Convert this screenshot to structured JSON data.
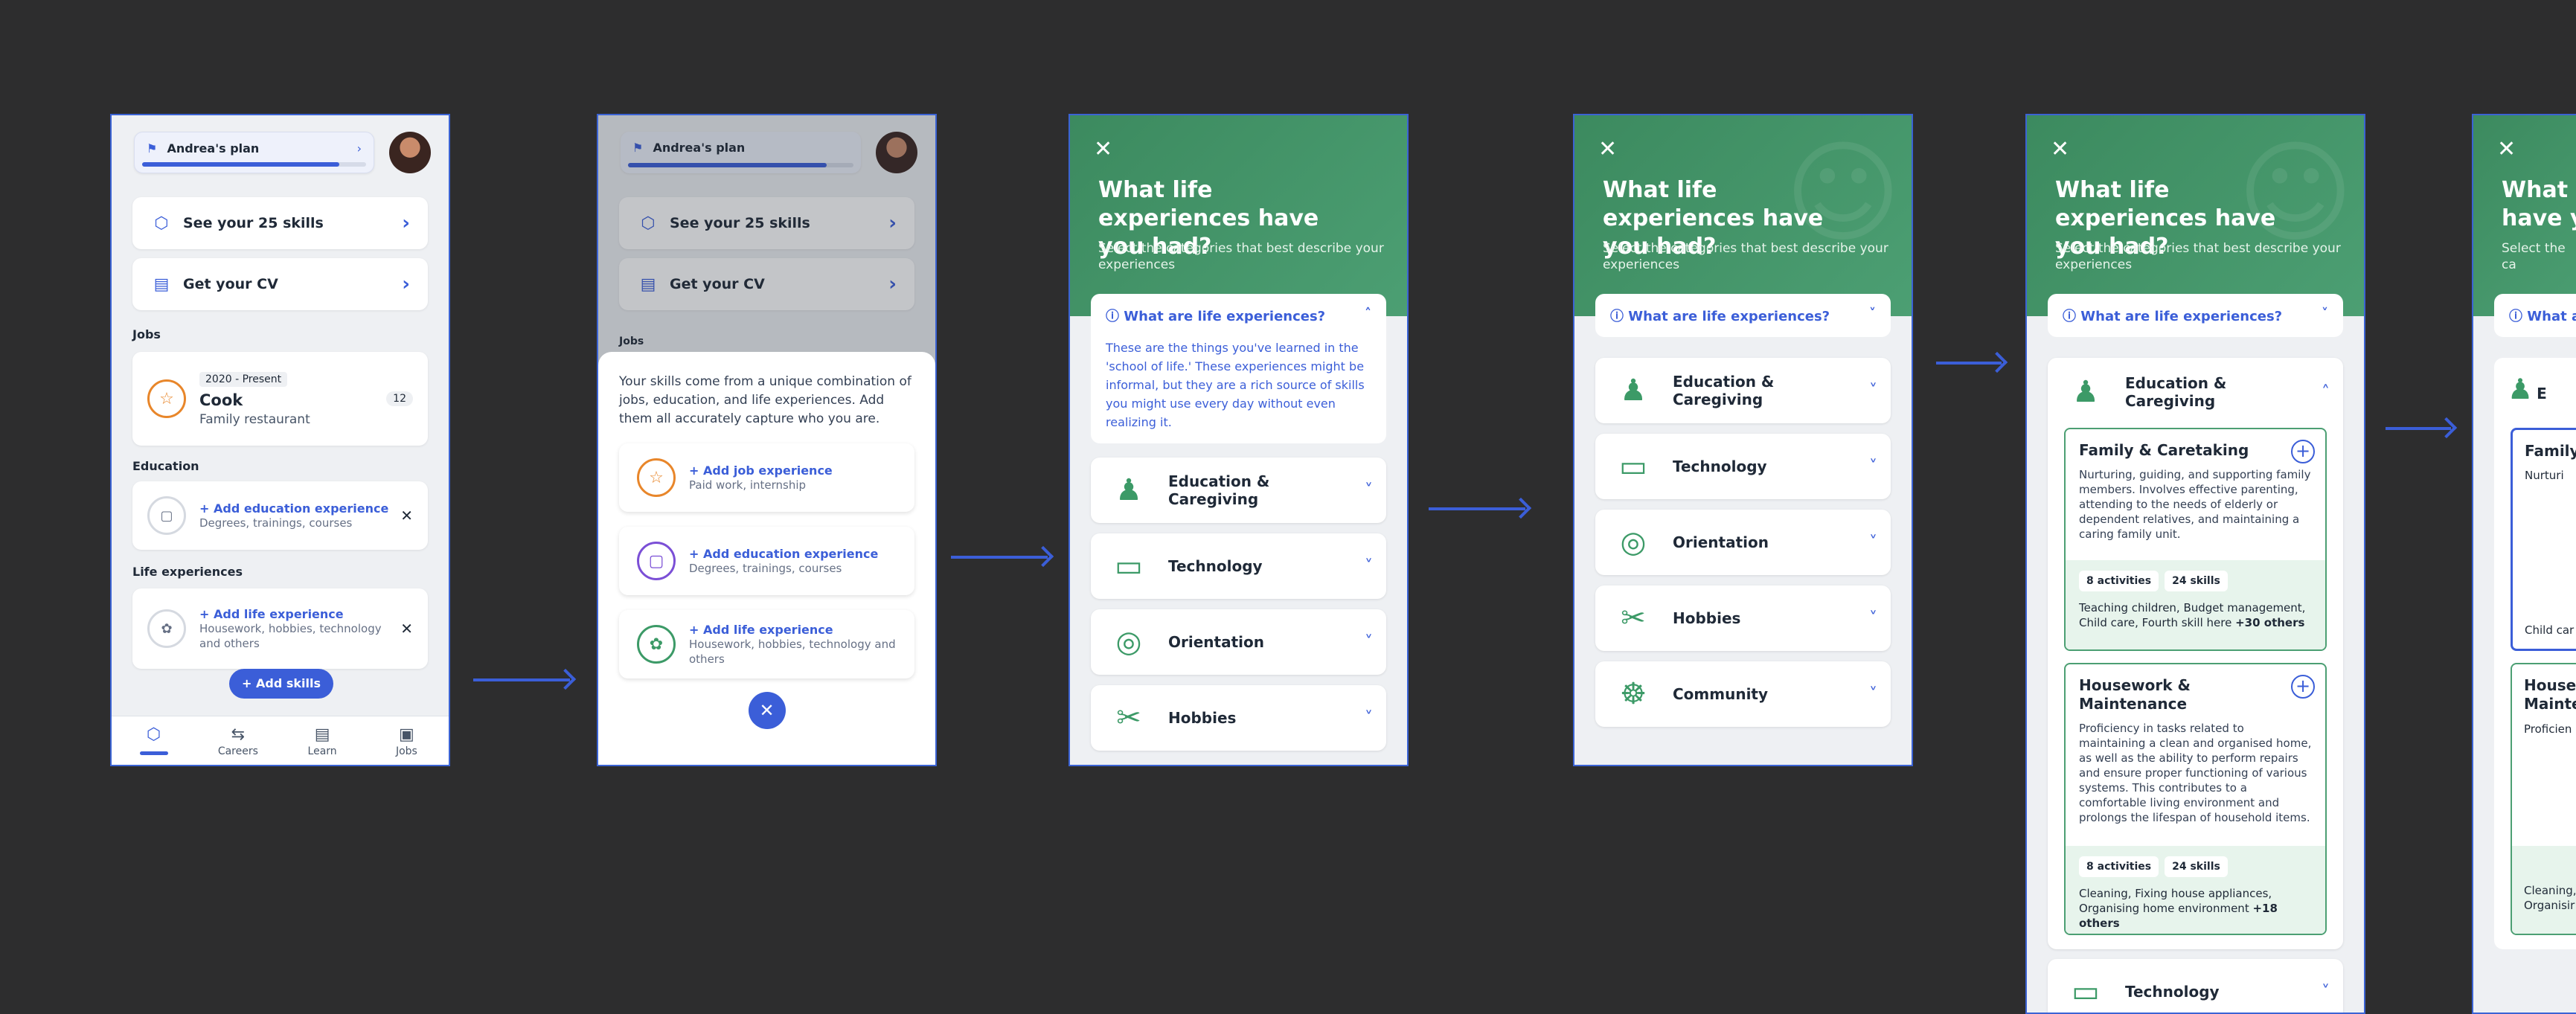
{
  "plan": {
    "title": "Andrea's plan",
    "progress": 0.88
  },
  "skills_link": "See your 25 skills",
  "cv_link": "Get your CV",
  "sections": {
    "jobs": "Jobs",
    "education": "Education",
    "life": "Life experiences"
  },
  "job": {
    "period": "2020 - Present",
    "title": "Cook",
    "place": "Family restaurant",
    "count": "12"
  },
  "education_add": {
    "label": "Add education experience",
    "sub": "Degrees, trainings, courses"
  },
  "life_add": {
    "label": "Add life experience",
    "sub": "Housework, hobbies, technology and others"
  },
  "add_skills": "Add skills",
  "nav": [
    {
      "label": "Careers",
      "icon": "signpost-icon"
    },
    {
      "label": "Learn",
      "icon": "document-icon"
    },
    {
      "label": "Jobs",
      "icon": "briefcase-icon"
    }
  ],
  "sheet": {
    "intro": "Your skills come from a unique combination of jobs, education, and life experiences. Add them all accurately capture who you are.",
    "options": [
      {
        "label": "Add job experience",
        "sub": "Paid work, internship",
        "color": "#e8862a",
        "icon": "☆"
      },
      {
        "label": "Add education experience",
        "sub": "Degrees, trainings, courses",
        "color": "#7b4fd6",
        "icon": "▢"
      },
      {
        "label": "Add life experience",
        "sub": "Housework, hobbies, technology and others",
        "color": "#3c9a67",
        "icon": "✿"
      }
    ]
  },
  "life_screen": {
    "title": "What life experiences have you had?",
    "subtitle": "Select the categories that best describe your experiences",
    "info_q": "What are life experiences?",
    "info_a": "These are the things you've learned in the 'school of life.' These experiences might be informal, but they are a rich source of skills you might use every day without even realizing it.",
    "categories": [
      "Education & Caregiving",
      "Technology",
      "Orientation",
      "Hobbies",
      "Community"
    ]
  },
  "experiences": [
    {
      "title": "Family & Caretaking",
      "desc": "Nurturing, guiding, and supporting family members. Involves effective parenting, attending to the needs of elderly or dependent relatives, and maintaining a caring family unit.",
      "activities": "8 activities",
      "skills": "24 skills",
      "examples": "Teaching children, Budget management, Child care, Fourth skill here",
      "more": "+30 others"
    },
    {
      "title": "Housework & Maintenance",
      "desc": "Proficiency in tasks related to maintaining a clean and organised home, as well as the ability to perform repairs and ensure proper functioning of various systems. This contributes to a comfortable living environment and prolongs the lifespan of household items.",
      "activities": "8 activities",
      "skills": "24 skills",
      "examples": "Cleaning, Fixing house appliances, Organising home environment",
      "more": "+18 others"
    }
  ],
  "partial": {
    "title": "What li",
    "title2": "have yo",
    "sub": "Select the ca",
    "info": "What a",
    "exp1": "Family",
    "exp1b": "Nurturi",
    "exp2": "Housev",
    "exp2b": "Mainte",
    "e2d": "Proficien",
    "e2d2": "Cleaning,",
    "e2d3": "Organisir",
    "e1d": "Child car",
    "cat": "E"
  }
}
